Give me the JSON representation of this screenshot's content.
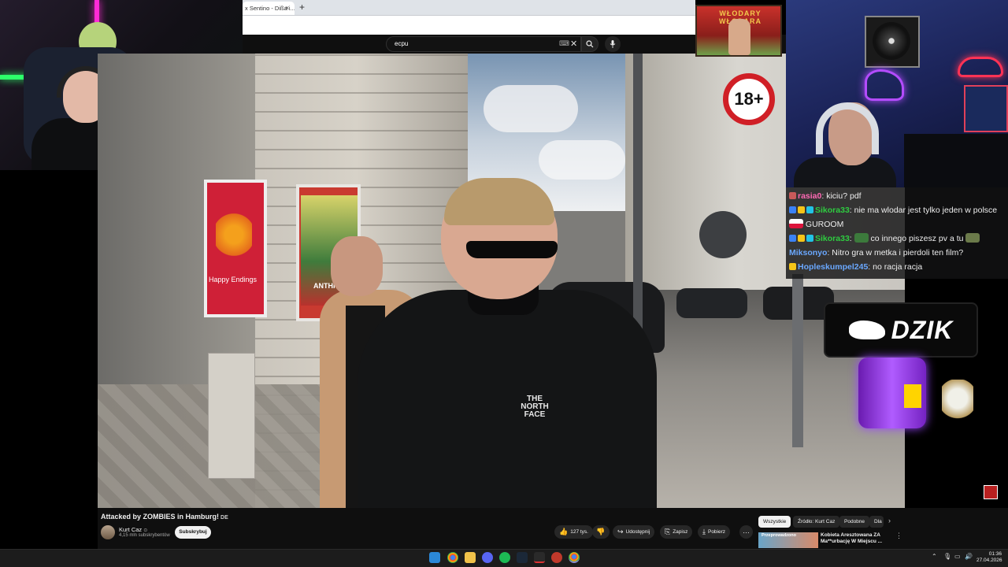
{
  "browser": {
    "tab_title": "x Sentino - Dißa i...",
    "tab_close": "×",
    "new_tab": "+"
  },
  "youtube": {
    "search_value": "ecpu",
    "search_kbd": "⌨",
    "clear": "✕",
    "search_icon": "search-icon",
    "mic_icon": "mic-icon",
    "video_title": "Attacked by ZOMBIES in Hamburg!",
    "title_flag": "DE",
    "channel_name": "Kurt Caz",
    "channel_verified": "⊙",
    "subscribers": "4,15 mln subskrybentów",
    "subscribe_label": "Subskrybuj",
    "likes": "127 tys.",
    "share_label": "Udostępnij",
    "save_label": "Zapisz",
    "download_label": "Pobierz",
    "more": "…",
    "chips": [
      "Wszystkie",
      "Źródło: Kurt Caz",
      "Podobne",
      "Dla"
    ],
    "chip_next": "›",
    "recommendation_title": "Kobieta Aresztowana ZA Ma**urbację W Miejscu ...",
    "recommendation_thumb_text": "Przeprowadzono"
  },
  "overlay": {
    "age_badge": "18+",
    "banner_text": "WŁODARY WŁODARA",
    "dzik_text": "DZIK"
  },
  "video_scene": {
    "poster1_text": "Happy Endings",
    "poster2_text": "ANTHRO",
    "jacket_logo": "THE NORTH FACE"
  },
  "chat": {
    "messages": [
      {
        "user": "rasia0",
        "text": "kiciu? pdf",
        "color": "#ff69b4"
      },
      {
        "user": "Sikora33",
        "text": "nie ma wlodar jest tylko jeden w polsce",
        "color": "#2ecc40",
        "text2": "GUROOM"
      },
      {
        "user": "Sikora33",
        "text": "co innego piszesz pv a tu",
        "color": "#2ecc40"
      },
      {
        "user": "Miksonyo",
        "text": "Nitro gra w metka i pierdoli ten film?",
        "color": "#6aa8ff"
      },
      {
        "user": "Hopleskumpel245",
        "text": "no racja racja",
        "color": "#6aa8ff"
      }
    ]
  },
  "taskbar": {
    "time": "01:36",
    "date": "27.04.2026",
    "tray_chevron": "⌃"
  },
  "colors": {
    "yt_bg": "#0f0f0f",
    "age_red": "#d01f26",
    "dzik_purple": "#9a44ff"
  }
}
